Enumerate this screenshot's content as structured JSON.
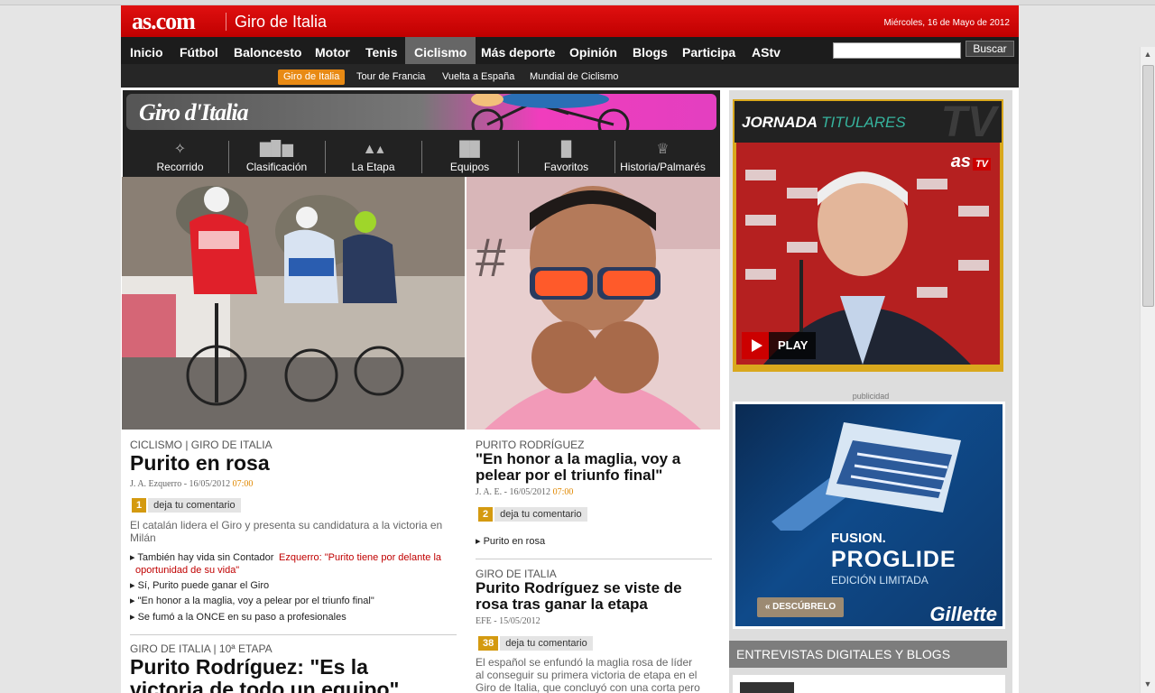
{
  "header": {
    "logo": "as.com",
    "section": "Giro de Italia",
    "date": "Miércoles, 16 de Mayo de 2012"
  },
  "nav": {
    "items": [
      "Inicio",
      "Fútbol",
      "Baloncesto",
      "Motor",
      "Tenis",
      "Ciclismo",
      "Más deporte",
      "Opinión",
      "Blogs",
      "Participa",
      "AStv"
    ],
    "active": "Ciclismo",
    "search_button": "Buscar"
  },
  "subnav": {
    "items": [
      "Giro de Italia",
      "Tour de Francia",
      "Vuelta a España",
      "Mundial de Ciclismo"
    ],
    "active": "Giro de Italia"
  },
  "giro": {
    "logo": "Giro d'Italia",
    "menu": [
      {
        "label": "Recorrido",
        "icon": "route-icon"
      },
      {
        "label": "Clasificación",
        "icon": "podium-icon"
      },
      {
        "label": "La Etapa",
        "icon": "mountain-icon"
      },
      {
        "label": "Equipos",
        "icon": "jerseys-icon"
      },
      {
        "label": "Favoritos",
        "icon": "jersey-icon"
      },
      {
        "label": "Historia/Palmarés",
        "icon": "trophy-icon"
      }
    ]
  },
  "article1": {
    "kicker": "CICLISMO | GIRO DE ITALIA",
    "headline": "Purito en rosa",
    "byline": "J. A. Ezquerro - 16/05/2012",
    "time": "07:00",
    "comment_count": "1",
    "comment_label": "deja tu comentario",
    "summary": "El catalán lidera el Giro y presenta su candidatura a la victoria en Milán",
    "links": [
      "También hay vida sin Contador",
      "Sí, Purito puede ganar el Giro",
      "\"En honor a la maglia, voy a pelear por el triunfo final\"",
      "Se fumó a la ONCE en su paso a profesionales"
    ],
    "red_link_1": "Ezquerro: \"Purito tiene por delante la",
    "red_link_2": "oportunidad de su vida\""
  },
  "article2": {
    "kicker": "GIRO DE ITALIA | 10ª ETAPA",
    "headline_1": "Purito Rodríguez: \"Es la",
    "headline_2": "victoria de todo un equipo\""
  },
  "article3": {
    "kicker": "PURITO RODRÍGUEZ",
    "headline_1": "\"En honor a la maglia, voy a",
    "headline_2": "pelear por el triunfo final\"",
    "byline": "J. A. E. - 16/05/2012",
    "time": "07:00",
    "comment_count": "2",
    "comment_label": "deja tu comentario",
    "link": "Purito en rosa"
  },
  "article4": {
    "kicker": "GIRO DE ITALIA",
    "headline_1": "Purito Rodríguez se viste de",
    "headline_2": "rosa tras ganar la etapa",
    "byline": "EFE - 15/05/2012",
    "comment_count": "38",
    "comment_label": "deja tu comentario",
    "summary_1": "El español se enfundó la maglia rosa de líder",
    "summary_2": "al conseguir su primera victoria de etapa en el",
    "summary_3": "Giro de Italia, que concluyó con una corta pero"
  },
  "tv": {
    "title_a": "JORNADA",
    "title_b": "TITULARES",
    "watermark": "TV",
    "brand": "as",
    "brand_tv": "TV",
    "play": "PLAY"
  },
  "ad": {
    "label": "publicidad",
    "fusion": "FUSION.",
    "proglide": "PROGLIDE",
    "edition": "EDICIÓN LIMITADA",
    "cta": "DESCÚBRELO",
    "brand": "Gillette"
  },
  "blogs": {
    "title": "ENTREVISTAS DIGITALES Y BLOGS"
  },
  "colors": {
    "brand_red": "#d40000",
    "accent_orange": "#e88a14",
    "comment_gold": "#d49a10",
    "nav_dark": "#1c1c1c"
  }
}
